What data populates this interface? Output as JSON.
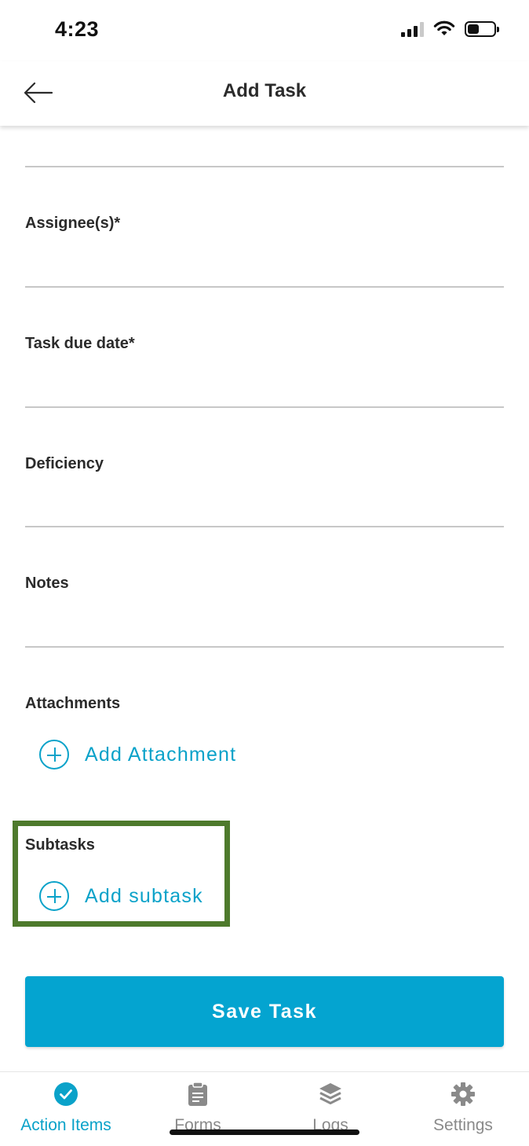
{
  "status_bar": {
    "time": "4:23"
  },
  "header": {
    "title": "Add Task"
  },
  "form": {
    "fields": [
      {
        "label": "Assignee(s)*"
      },
      {
        "label": "Task due date*"
      },
      {
        "label": "Deficiency"
      },
      {
        "label": "Notes"
      }
    ],
    "attachments": {
      "label": "Attachments",
      "add_label": "Add Attachment"
    },
    "subtasks": {
      "label": "Subtasks",
      "add_label": "Add subtask"
    },
    "save_label": "Save Task"
  },
  "bottom_nav": {
    "items": [
      {
        "label": "Action Items",
        "icon": "check-circle-icon",
        "active": true
      },
      {
        "label": "Forms",
        "icon": "clipboard-icon",
        "active": false
      },
      {
        "label": "Logs",
        "icon": "layers-icon",
        "active": false
      },
      {
        "label": "Settings",
        "icon": "gear-icon",
        "active": false
      }
    ]
  },
  "colors": {
    "accent": "#0aa2c9",
    "button": "#04a4d0",
    "highlight": "#4e7a2c",
    "inactive": "#8a8a8a"
  }
}
